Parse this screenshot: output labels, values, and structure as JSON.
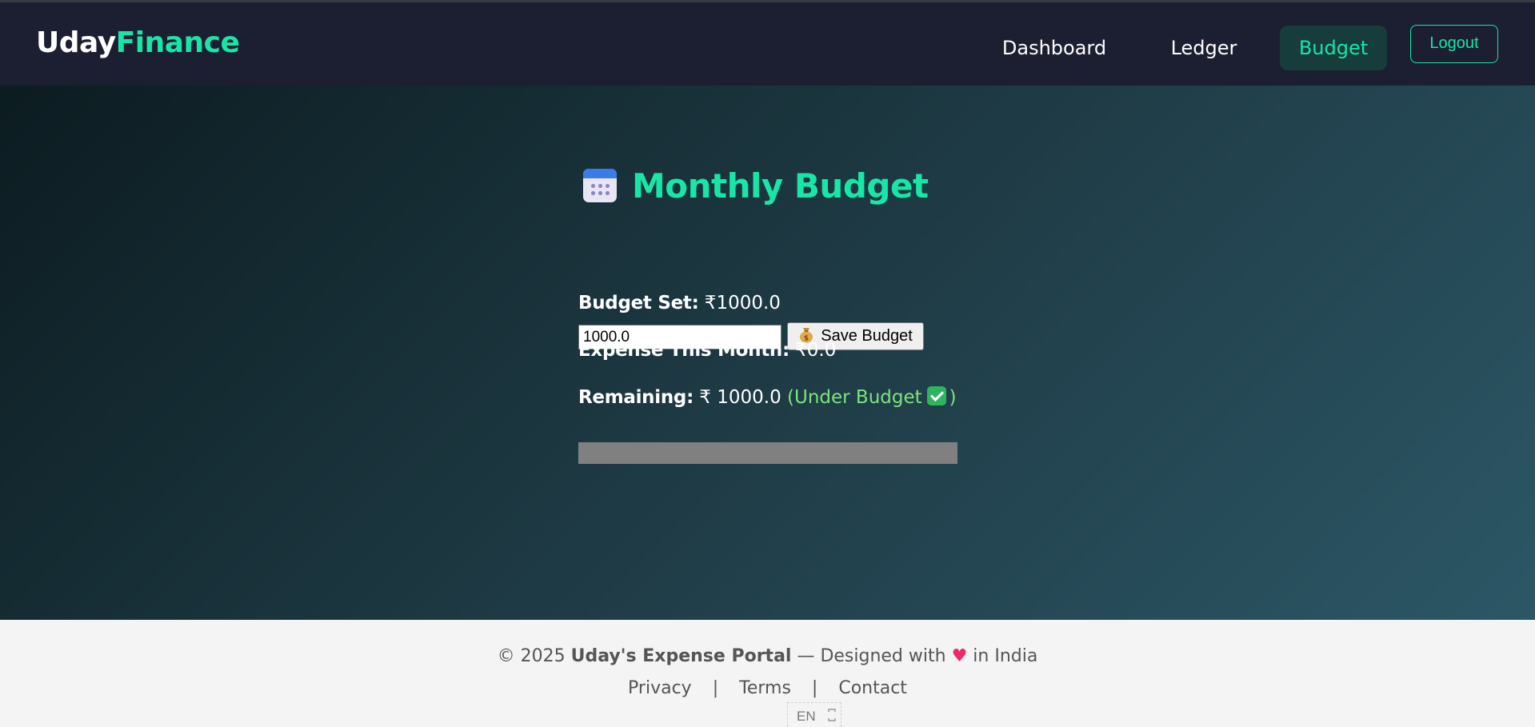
{
  "brand": {
    "part1": "Uday",
    "part2": "Finance"
  },
  "nav": {
    "dashboard": "Dashboard",
    "ledger": "Ledger",
    "budget": "Budget",
    "logout": "Logout"
  },
  "page": {
    "icon": "calendar-icon",
    "title": "Monthly Budget"
  },
  "budget_form": {
    "input_value": "1000.0",
    "save_icon": "money-bag-icon",
    "save_label": "Save Budget"
  },
  "stats": {
    "budget_label": "Budget Set:",
    "budget_value": " ₹1000.0",
    "expense_label": "Expense This Month:",
    "expense_value": " ₹0.0",
    "remaining_label": "Remaining:",
    "remaining_value": " ₹ 1000.0 ",
    "status_open": "(Under Budget",
    "status_icon": "check-mark-icon",
    "status_close": ")"
  },
  "progress": {
    "spent_fraction": 0
  },
  "footer": {
    "copyright_prefix": "© 2025 ",
    "portal_name": "Uday's Expense Portal",
    "designed_prefix": " — Designed with ",
    "heart_icon": "heart-icon",
    "designed_suffix": " in India",
    "links": [
      "Privacy",
      "Terms",
      "Contact"
    ],
    "separator": "|"
  },
  "language": {
    "code": "EN"
  },
  "colors": {
    "accent": "#18e6a6",
    "navbar_bg": "#1c1f31",
    "status_ok": "#7be37e",
    "progress_track": "#808080"
  }
}
